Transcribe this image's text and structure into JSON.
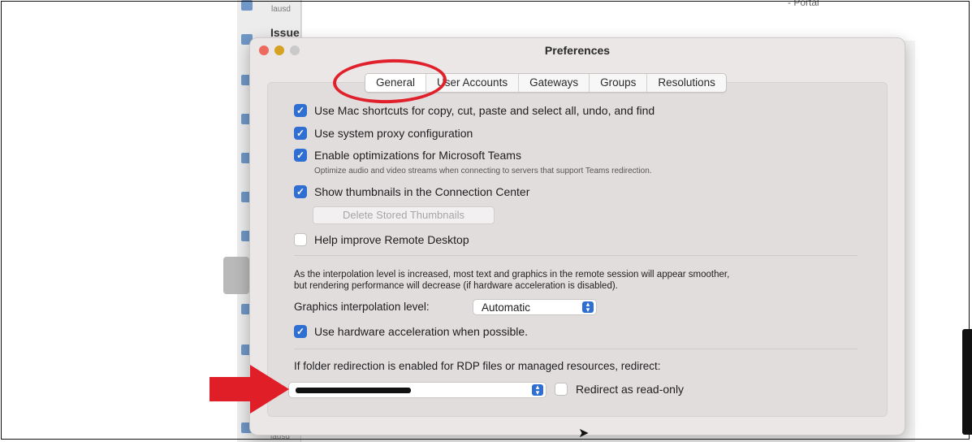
{
  "background": {
    "sidebar_label_top": "lausd",
    "sidebar_heading": "Issue",
    "sidebar_label_bottom": "lausd",
    "header_partial": "- Portal"
  },
  "dialog": {
    "title": "Preferences",
    "tabs": [
      {
        "label": "General",
        "selected": true
      },
      {
        "label": "User Accounts",
        "selected": false
      },
      {
        "label": "Gateways",
        "selected": false
      },
      {
        "label": "Groups",
        "selected": false
      },
      {
        "label": "Resolutions",
        "selected": false
      }
    ],
    "options": {
      "mac_shortcuts": {
        "label": "Use Mac shortcuts for copy, cut, paste and select all, undo, and find",
        "checked": true
      },
      "system_proxy": {
        "label": "Use system proxy configuration",
        "checked": true
      },
      "teams": {
        "label": "Enable optimizations for Microsoft Teams",
        "checked": true,
        "description": "Optimize audio and video streams when connecting to servers that support Teams redirection."
      },
      "thumbnails": {
        "label": "Show thumbnails in the Connection Center",
        "checked": true
      },
      "delete_thumbnails_button": "Delete Stored Thumbnails",
      "help_improve": {
        "label": "Help improve Remote Desktop",
        "checked": false
      }
    },
    "interpolation": {
      "description_line1": "As the interpolation level is increased, most text and graphics in the remote session will appear smoother,",
      "description_line2": "but rendering performance will decrease (if hardware acceleration is disabled).",
      "label": "Graphics interpolation level:",
      "value": "Automatic"
    },
    "hardware_accel": {
      "label": "Use hardware acceleration when possible.",
      "checked": true
    },
    "folder_redirection": {
      "label": "If folder redirection is enabled for RDP files or managed resources, redirect:",
      "read_only": {
        "label": "Redirect as read-only",
        "checked": false
      }
    }
  },
  "colors": {
    "accent": "#2f6fd2",
    "annotation_red": "#e01e27"
  }
}
